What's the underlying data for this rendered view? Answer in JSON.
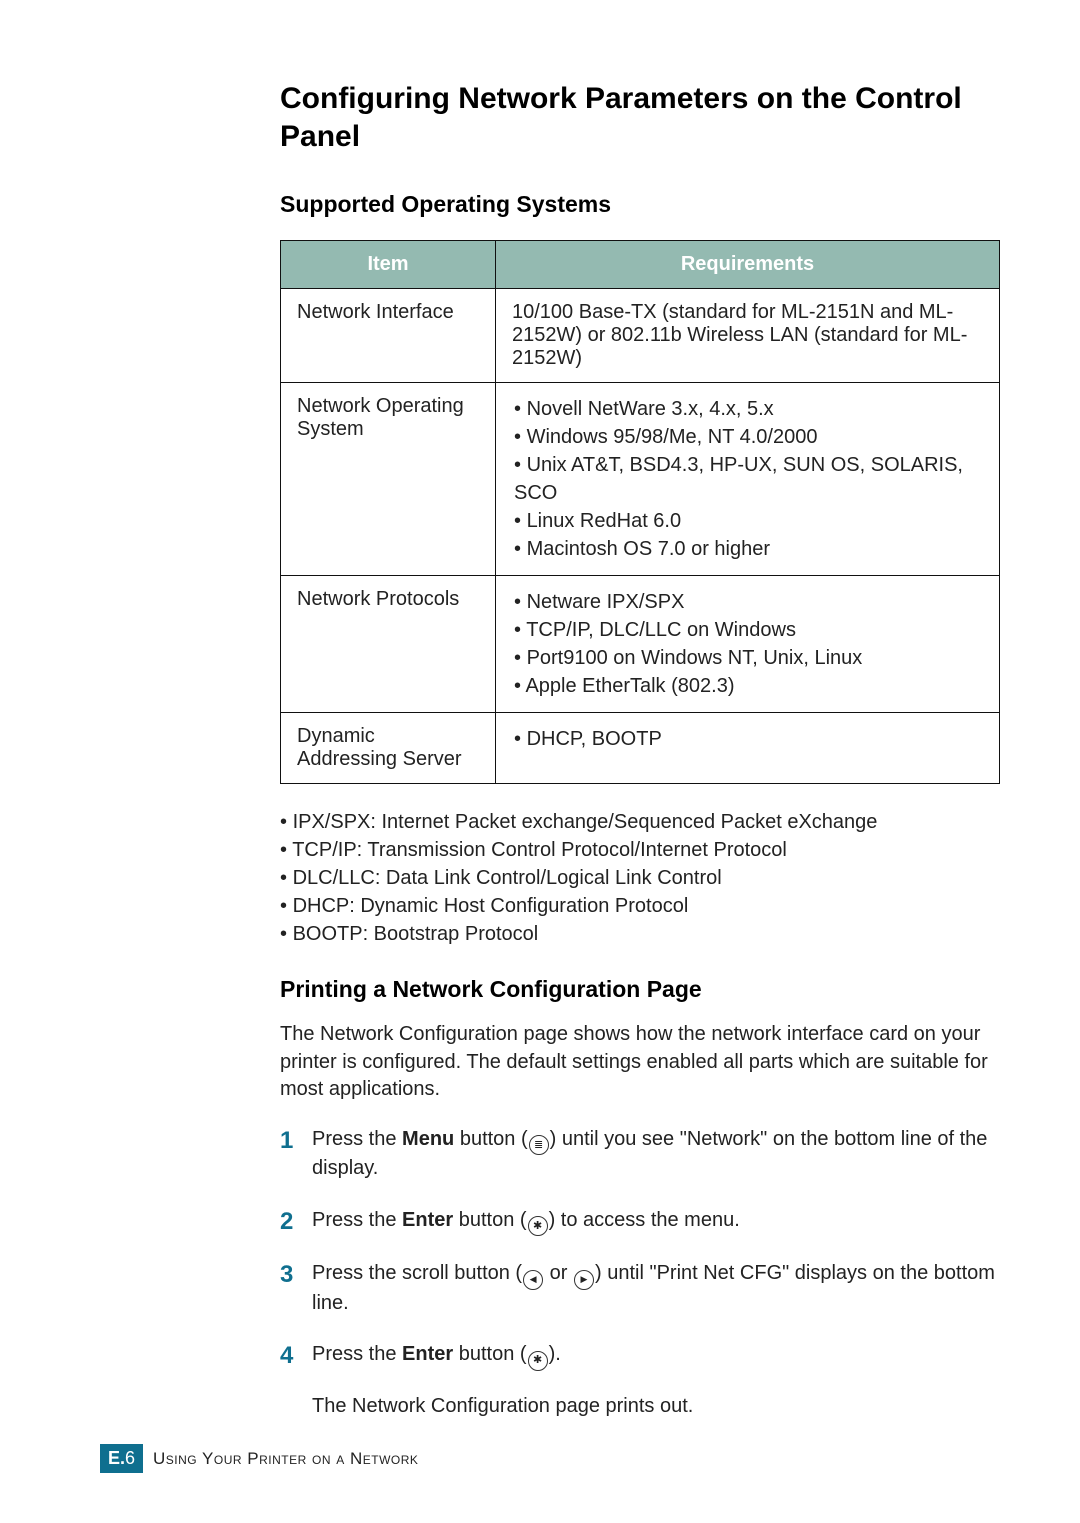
{
  "title": "Configuring Network Parameters on the Control Panel",
  "section1": {
    "heading": "Supported Operating Systems",
    "table": {
      "headers": {
        "item": "Item",
        "req": "Requirements"
      },
      "rows": [
        {
          "item": "Network Interface",
          "req_text": "10/100 Base-TX (standard for ML-2151N and ML-2152W) or 802.11b Wireless LAN (standard for ML-2152W)"
        },
        {
          "item": "Network Operating System",
          "bullets": [
            "Novell NetWare 3.x, 4.x, 5.x",
            "Windows 95/98/Me, NT 4.0/2000",
            "Unix AT&T, BSD4.3, HP-UX, SUN OS, SOLARIS, SCO",
            "Linux RedHat 6.0",
            "Macintosh OS 7.0 or higher"
          ]
        },
        {
          "item": "Network Protocols",
          "bullets": [
            "Netware IPX/SPX",
            "TCP/IP, DLC/LLC on Windows",
            "Port9100 on Windows NT, Unix, Linux",
            "Apple EtherTalk (802.3)"
          ]
        },
        {
          "item": "Dynamic Addressing Server",
          "bullets": [
            "DHCP, BOOTP"
          ]
        }
      ]
    },
    "definitions": [
      "IPX/SPX: Internet Packet exchange/Sequenced Packet eXchange",
      "TCP/IP: Transmission Control Protocol/Internet Protocol",
      "DLC/LLC: Data Link Control/Logical Link Control",
      "DHCP: Dynamic Host Configuration Protocol",
      "BOOTP: Bootstrap Protocol"
    ]
  },
  "section2": {
    "heading": "Printing a Network Configuration Page",
    "intro": "The Network Configuration page shows how the network interface card on your printer is configured. The default settings enabled all parts which are suitable for most applications.",
    "steps": [
      {
        "num": "1",
        "pre": "Press the ",
        "bold": "Menu",
        "mid": " button (",
        "icon": "menu",
        "post": ") until you see \"Network\" on the bottom line of the display."
      },
      {
        "num": "2",
        "pre": "Press the ",
        "bold": "Enter",
        "mid": " button (",
        "icon": "enter",
        "post": ") to access the menu."
      },
      {
        "num": "3",
        "pre": "Press the scroll button (",
        "icon_pair": true,
        "mid2": " or ",
        "post": ") until \"Print Net CFG\" displays on the bottom line."
      },
      {
        "num": "4",
        "pre": "Press the ",
        "bold": "Enter",
        "mid": " button (",
        "icon": "enter",
        "post": ").",
        "sub": "The Network Configuration page prints out."
      }
    ]
  },
  "footer": {
    "badge_letter": "E.",
    "badge_page": "6",
    "text": "Using Your Printer on a Network"
  }
}
